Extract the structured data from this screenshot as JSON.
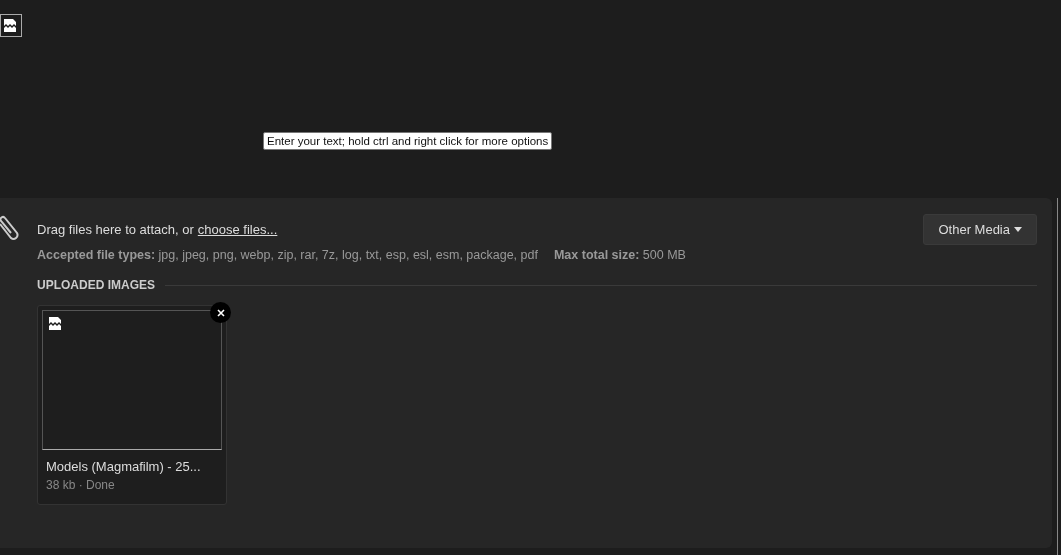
{
  "editor": {
    "tooltip": "Enter your text; hold ctrl and right click for more options"
  },
  "attach": {
    "prompt": "Drag files here to attach, or",
    "link": "choose files...",
    "types_label": "Accepted file types:",
    "types": "jpg, jpeg, png, webp, zip, rar, 7z, log, txt, esp, esl, esm, package, pdf",
    "size_label": "Max total size:",
    "size": "500 MB",
    "media_button": "Other Media"
  },
  "uploaded": {
    "heading": "UPLOADED IMAGES",
    "files": [
      {
        "name": "Models (Magmafilm) - 25...",
        "status": "38 kb · Done"
      }
    ]
  }
}
